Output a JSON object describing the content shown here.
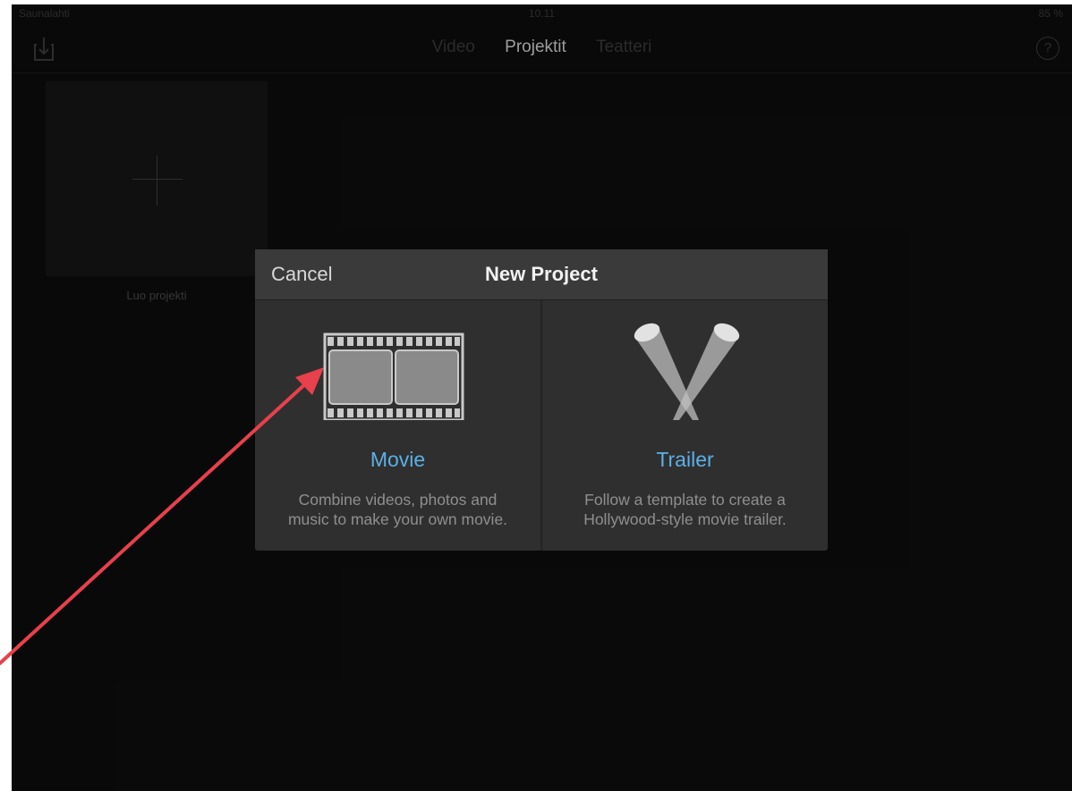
{
  "status_bar": {
    "carrier": "Saunalahti",
    "time": "10.11",
    "battery": "85 %"
  },
  "nav": {
    "tabs": [
      {
        "label": "Video",
        "active": false
      },
      {
        "label": "Projektit",
        "active": true
      },
      {
        "label": "Teatteri",
        "active": false
      }
    ],
    "import_icon": "import-icon",
    "help_icon": "help-icon",
    "help_label": "?"
  },
  "projects": {
    "create_label": "Luo projekti",
    "create_icon": "plus-icon"
  },
  "dialog": {
    "cancel_label": "Cancel",
    "title": "New Project",
    "options": [
      {
        "title": "Movie",
        "icon": "film-strip-icon",
        "description_line1": "Combine videos, photos and",
        "description_line2": "music to make your own movie."
      },
      {
        "title": "Trailer",
        "icon": "spotlights-icon",
        "description_line1": "Follow a template to create a",
        "description_line2": "Hollywood-style movie trailer."
      }
    ]
  },
  "colors": {
    "background": "#0d0d0d",
    "dialog_bg": "#2f2f2f",
    "dialog_header": "#3a3a3a",
    "accent": "#5bb0e8",
    "annotation_arrow": "#e8404c"
  }
}
